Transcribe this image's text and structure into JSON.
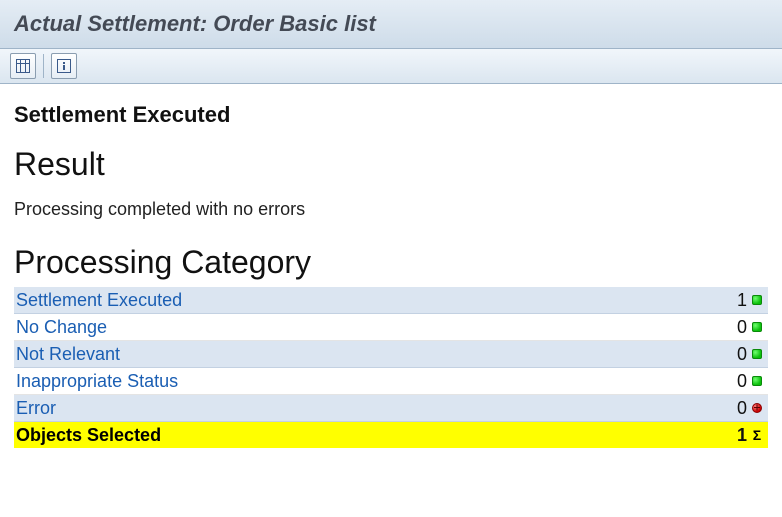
{
  "title": "Actual Settlement: Order Basic list",
  "toolbar": {
    "layout_icon": "layout-grid-icon",
    "info_icon": "info-icon"
  },
  "headings": {
    "executed": "Settlement Executed",
    "result": "Result",
    "processing_category": "Processing Category"
  },
  "message": "Processing completed with no errors",
  "categories": [
    {
      "label": "Settlement Executed",
      "count": 1,
      "status": "green",
      "shade": "blue"
    },
    {
      "label": "No Change",
      "count": 0,
      "status": "green",
      "shade": "white"
    },
    {
      "label": "Not Relevant",
      "count": 0,
      "status": "green",
      "shade": "blue"
    },
    {
      "label": "Inappropriate Status",
      "count": 0,
      "status": "green",
      "shade": "white"
    },
    {
      "label": "Error",
      "count": 0,
      "status": "red",
      "shade": "blue"
    }
  ],
  "total": {
    "label": "Objects Selected",
    "count": 1
  }
}
